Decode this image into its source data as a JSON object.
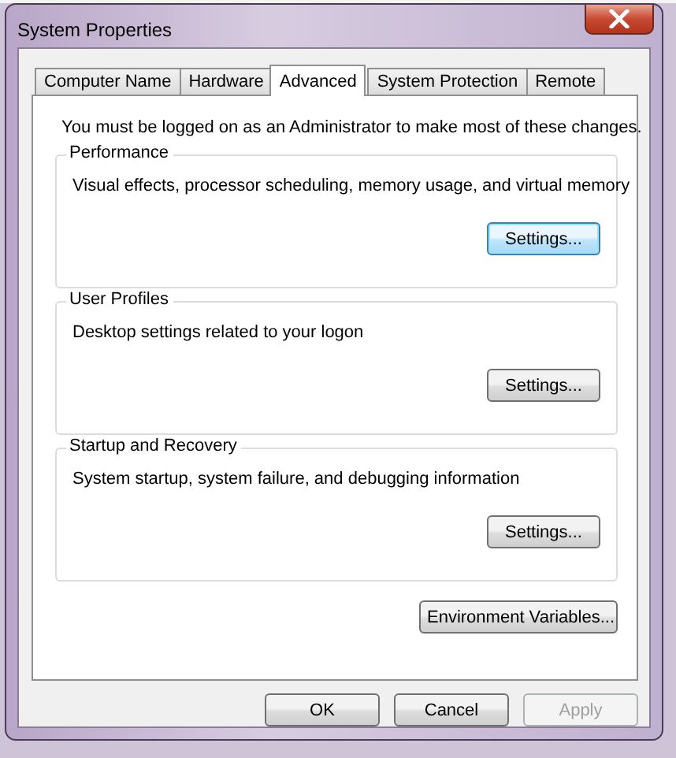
{
  "window": {
    "title": "System Properties"
  },
  "tabs": [
    {
      "label": "Computer Name",
      "selected": false
    },
    {
      "label": "Hardware",
      "selected": false
    },
    {
      "label": "Advanced",
      "selected": true
    },
    {
      "label": "System Protection",
      "selected": false
    },
    {
      "label": "Remote",
      "selected": false
    }
  ],
  "notice": "You must be logged on as an Administrator to make most of these changes.",
  "groups": [
    {
      "title": "Performance",
      "description": "Visual effects, processor scheduling, memory usage, and virtual memory",
      "button": {
        "label": "Settings...",
        "focused": true
      }
    },
    {
      "title": "User Profiles",
      "description": "Desktop settings related to your logon",
      "button": {
        "label": "Settings...",
        "focused": false
      }
    },
    {
      "title": "Startup and Recovery",
      "description": "System startup, system failure, and debugging information",
      "button": {
        "label": "Settings...",
        "focused": false
      }
    }
  ],
  "environment_button": {
    "label": "Environment Variables..."
  },
  "buttons": [
    {
      "label": "OK",
      "disabled": false
    },
    {
      "label": "Cancel",
      "disabled": false
    },
    {
      "label": "Apply",
      "disabled": true
    }
  ]
}
